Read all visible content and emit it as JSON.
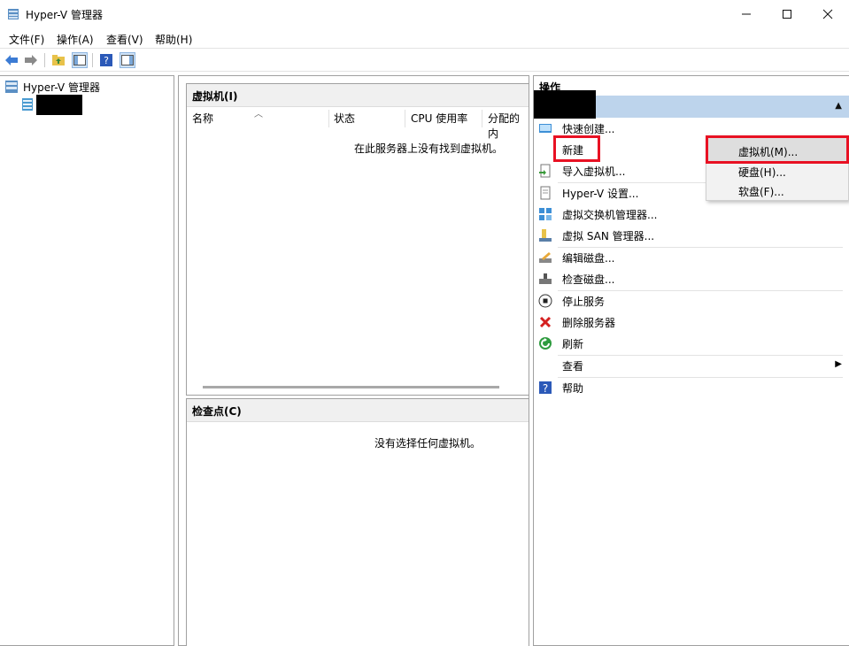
{
  "window": {
    "title": "Hyper-V 管理器"
  },
  "menu": [
    "文件(F)",
    "操作(A)",
    "查看(V)",
    "帮助(H)"
  ],
  "tree": {
    "root": "Hyper-V 管理器"
  },
  "vm_section": {
    "title": "虚拟机(I)",
    "columns": [
      "名称",
      "状态",
      "CPU 使用率",
      "分配的内"
    ],
    "empty": "在此服务器上没有找到虚拟机。"
  },
  "checkpoint_section": {
    "title": "检查点(C)",
    "empty": "没有选择任何虚拟机。"
  },
  "actions": {
    "title": "操作",
    "items": [
      "快速创建...",
      "新建",
      "导入虚拟机...",
      "Hyper-V 设置...",
      "虚拟交换机管理器...",
      "虚拟 SAN 管理器...",
      "编辑磁盘...",
      "检查磁盘...",
      "停止服务",
      "删除服务器",
      "刷新",
      "查看",
      "帮助"
    ]
  },
  "new_submenu": [
    "虚拟机(M)...",
    "硬盘(H)...",
    "软盘(F)..."
  ],
  "colors": {
    "highlight": "#e81123",
    "actions_header": "#bdd4ec"
  }
}
